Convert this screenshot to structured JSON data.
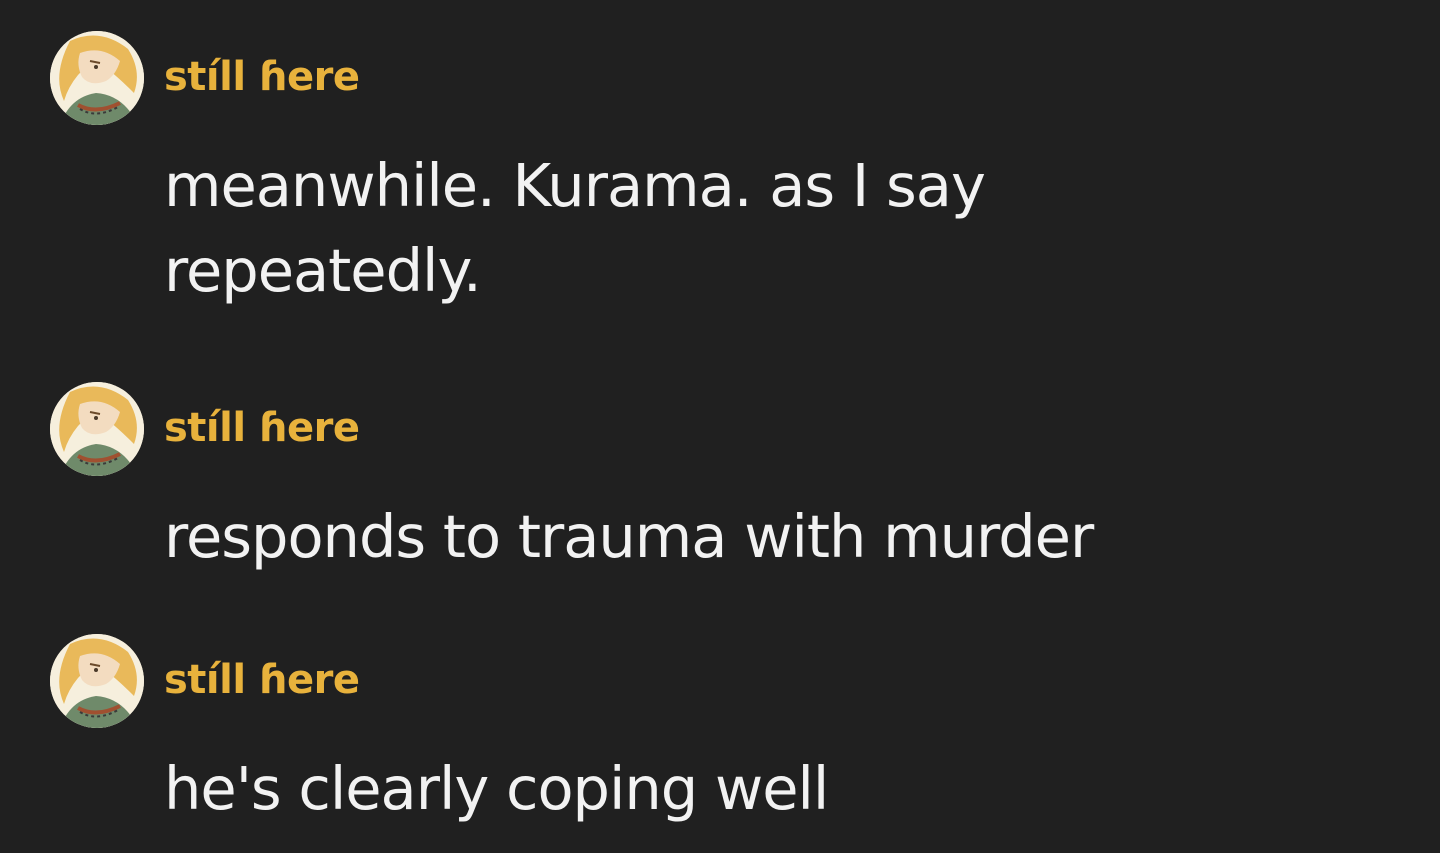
{
  "theme": {
    "background": "#202020",
    "username_color": "#e8b23c",
    "text_color": "#f2f2f2"
  },
  "messages": [
    {
      "author": "stíll ɦere",
      "avatar_icon": "anime-character-avatar-icon",
      "text": "meanwhile. Kurama. as I say repeatedly."
    },
    {
      "author": "stíll ɦere",
      "avatar_icon": "anime-character-avatar-icon",
      "text": "responds to trauma with murder"
    },
    {
      "author": "stíll ɦere",
      "avatar_icon": "anime-character-avatar-icon",
      "text": "he's clearly coping well"
    }
  ]
}
